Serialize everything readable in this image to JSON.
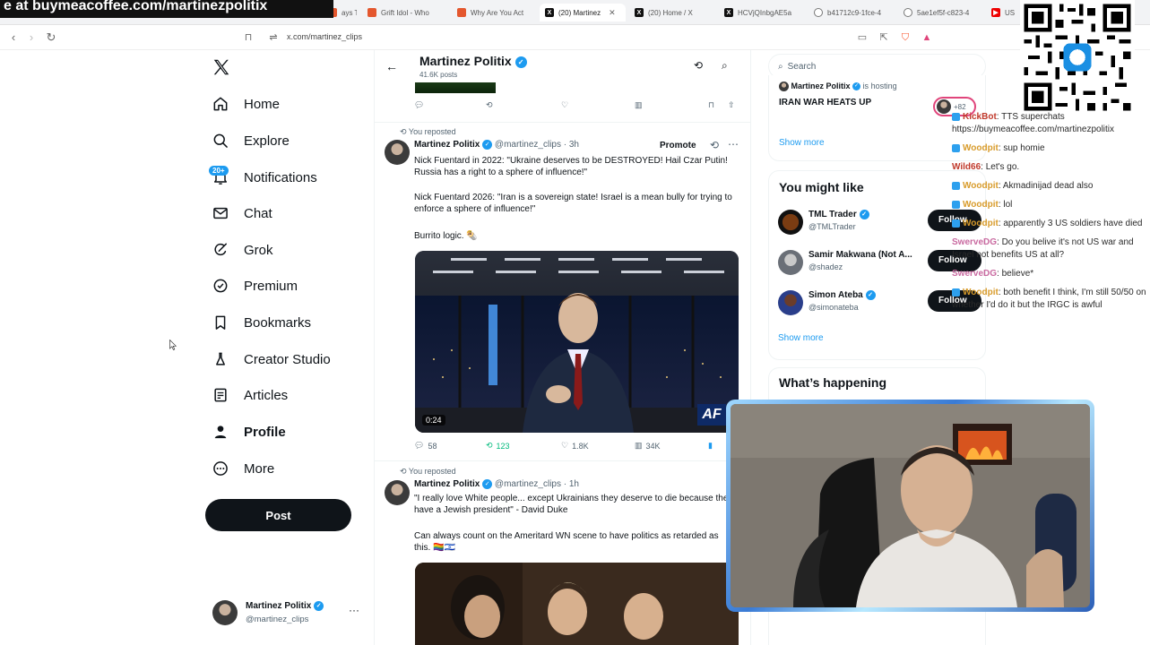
{
  "banner_text": "e at buymeacoffee.com/martinezpolitix",
  "tabs": [
    {
      "label": "ays T",
      "fav": "o"
    },
    {
      "label": "Grift Idol - Who",
      "fav": "o"
    },
    {
      "label": "Why Are You Act",
      "fav": "o"
    },
    {
      "label": "(20) Martinez",
      "fav": "x",
      "active": true
    },
    {
      "label": "(20) Home / X",
      "fav": "x"
    },
    {
      "label": "HCVjQInbgAE5a",
      "fav": "x"
    },
    {
      "label": "b41712c9-1fce-4",
      "fav": "g"
    },
    {
      "label": "5ae1ef5f-c823-4",
      "fav": "g"
    },
    {
      "label": "US",
      "fav": "y"
    }
  ],
  "address": {
    "url": "x.com/martinez_clips"
  },
  "nav": {
    "items": [
      {
        "label": "Home",
        "icon": "home-icon"
      },
      {
        "label": "Explore",
        "icon": "search-icon"
      },
      {
        "label": "Notifications",
        "icon": "bell-icon"
      },
      {
        "label": "Chat",
        "icon": "mail-icon"
      },
      {
        "label": "Grok",
        "icon": "grok-icon"
      },
      {
        "label": "Premium",
        "icon": "premium-icon"
      },
      {
        "label": "Bookmarks",
        "icon": "bookmark-icon"
      },
      {
        "label": "Creator Studio",
        "icon": "flask-icon"
      },
      {
        "label": "Articles",
        "icon": "article-icon"
      },
      {
        "label": "Profile",
        "icon": "person-icon"
      },
      {
        "label": "More",
        "icon": "more-circle-icon"
      }
    ],
    "notifications_badge": "20+",
    "post_label": "Post",
    "account": {
      "name": "Martinez Politix",
      "handle": "@martinez_clips"
    }
  },
  "profile_header": {
    "name": "Martinez Politix",
    "posts": "41.6K posts"
  },
  "tweet1": {
    "repost_label": "You reposted",
    "name": "Martinez Politix",
    "handle": "@martinez_clips",
    "time": "· 3h",
    "promote": "Promote",
    "p1": "Nick Fuentard in 2022: \"Ukraine deserves to be DESTROYED! Hail Czar Putin! Russia has a right to a sphere of influence!\"",
    "p2": "Nick Fuentard 2026: \"Iran is a sovereign state! Israel is a mean bully for trying to enforce a sphere of influence!\"",
    "p3": "Burrito logic. 🌯",
    "video_time": "0:24",
    "video_logo": "AF",
    "replies": "58",
    "reposts": "123",
    "likes": "1.8K",
    "views": "34K"
  },
  "tweet2": {
    "repost_label": "You reposted",
    "name": "Martinez Politix",
    "handle": "@martinez_clips",
    "time": "· 1h",
    "p1": "\"I really love White people... except Ukrainians they deserve to die because they have a Jewish president\" - David Duke",
    "p2": "Can always count on the Ameritard WN scene to have politics as retarded as this. 🏳️‍🌈🇮🇱"
  },
  "right": {
    "search_placeholder": "Search",
    "space": {
      "host": "Martinez Politix",
      "hosting": "is hosting",
      "title": "IRAN WAR HEATS UP",
      "count": "+82"
    },
    "show_more": "Show more",
    "might_like_title": "You might like",
    "suggestions": [
      {
        "name": "TML Trader",
        "handle": "@TMLTrader",
        "verified": true
      },
      {
        "name": "Samir Makwana (Not A...",
        "handle": "@shadez",
        "verified": false
      },
      {
        "name": "Simon Ateba",
        "handle": "@simonateba",
        "verified": true
      }
    ],
    "follow_label": "Follow",
    "happening_title": "What’s happening"
  },
  "chat": [
    {
      "user": "KickBot",
      "color": "#c0392b",
      "text": ": TTS superchats https://buymeacoffee.com/martinezpolitix"
    },
    {
      "user": "Woodpit",
      "color": "#d89b2a",
      "text": ": sup homie"
    },
    {
      "user": "Wild66",
      "color": "#c0392b",
      "text": ": Let's go."
    },
    {
      "user": "Woodpit",
      "color": "#d89b2a",
      "text": ": Akmadinijad dead also"
    },
    {
      "user": "Woodpit",
      "color": "#d89b2a",
      "text": ": lol"
    },
    {
      "user": "Woodpit",
      "color": "#d89b2a",
      "text": ": apparently 3 US soldiers have died"
    },
    {
      "user": "SwerveDG",
      "color": "#c96aa0",
      "text": ": Do you belive it's not US war and Israel not benefits US at all?"
    },
    {
      "user": "SwerveDG",
      "color": "#c96aa0",
      "text": ": believe*"
    },
    {
      "user": "Woodpit",
      "color": "#d89b2a",
      "text": ": both benefit I think, I'm still 50/50 on whether I'd do it but the IRGC is awful"
    }
  ],
  "colors": {
    "accent": "#1d9bf0",
    "repost_green": "#00ba7c",
    "text": "#0f1419",
    "muted": "#536471"
  }
}
